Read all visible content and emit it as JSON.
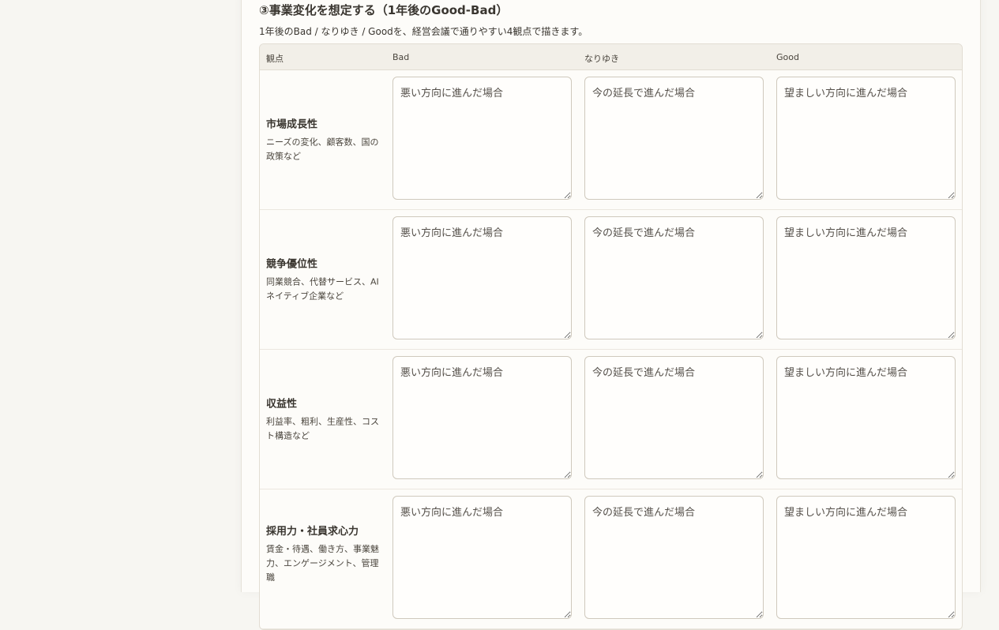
{
  "section": {
    "title": "③事業変化を想定する（1年後のGood-Bad）",
    "description": "1年後のBad / なりゆき / Goodを、経営会議で通りやすい4観点で描きます。"
  },
  "table": {
    "headers": [
      "観点",
      "Bad",
      "なりゆき",
      "Good"
    ],
    "placeholders": {
      "bad": "悪い方向に進んだ場合",
      "naruyuki": "今の延長で進んだ場合",
      "good": "望ましい方向に進んだ場合"
    },
    "rows": [
      {
        "title": "市場成長性",
        "desc": "ニーズの変化、顧客数、国の政策など"
      },
      {
        "title": "競争優位性",
        "desc": "同業競合、代替サービス、AIネイティブ企業など"
      },
      {
        "title": "収益性",
        "desc": "利益率、粗利、生産性、コスト構造など"
      },
      {
        "title": "採用力・社員求心力",
        "desc": "賃金・待遇、働き方、事業魅力、エンゲージメント、管理職"
      }
    ]
  }
}
